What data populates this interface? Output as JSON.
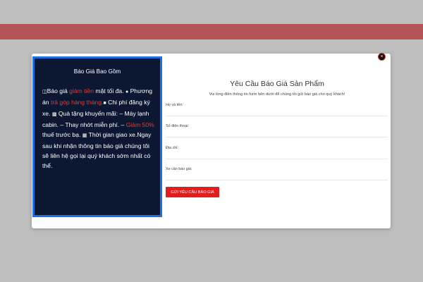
{
  "info": {
    "title": "Báo Giá Bao Gồm",
    "p1": "Báo giá ",
    "h1": "giảm tiền",
    "p2": " mặt tối đa. ",
    "p3": " Phương án ",
    "h2": "trả góp hàng tháng.",
    "p4": " Chi phí đăng ký xe. ",
    "p5": " Quà tặng khuyến mãi: – Máy lạnh cabin. – Thay nhớt miễn phí. – ",
    "h3": "Giảm 50%",
    "p6": " thuế trước bạ. ",
    "p7": " Thời gian giao xe.Ngay sau khi nhận thông tin báo giá chúng tôi sẽ liên hệ gọi lại quý khách sớm nhất có thể.",
    "icons": [
      "document-icon",
      "piggy-bank-icon",
      "chat-icon",
      "gift-icon",
      "calendar-icon"
    ]
  },
  "form": {
    "title": "Yêu Cầu Báo Giá Sản Phẩm",
    "subtitle": "Vui lòng điền thông tin form bên dưới để chúng tôi gửi báo giá cho quý khách!",
    "fields": [
      {
        "label": "Họ và tên:",
        "value": ""
      },
      {
        "label": "Số điện thoại:",
        "value": ""
      },
      {
        "label": "Địa chỉ:",
        "value": ""
      },
      {
        "label": "Xe cần báo giá:",
        "value": ""
      }
    ],
    "submit_label": "GỬI YÊU CẦU BÁO GIÁ"
  },
  "modal": {
    "close_label": "×"
  },
  "colors": {
    "banner": "#b55457",
    "panel_bg": "#0c1832",
    "panel_border": "#1f6fe0",
    "highlight": "#e23c3c",
    "button": "#e11d1d"
  }
}
